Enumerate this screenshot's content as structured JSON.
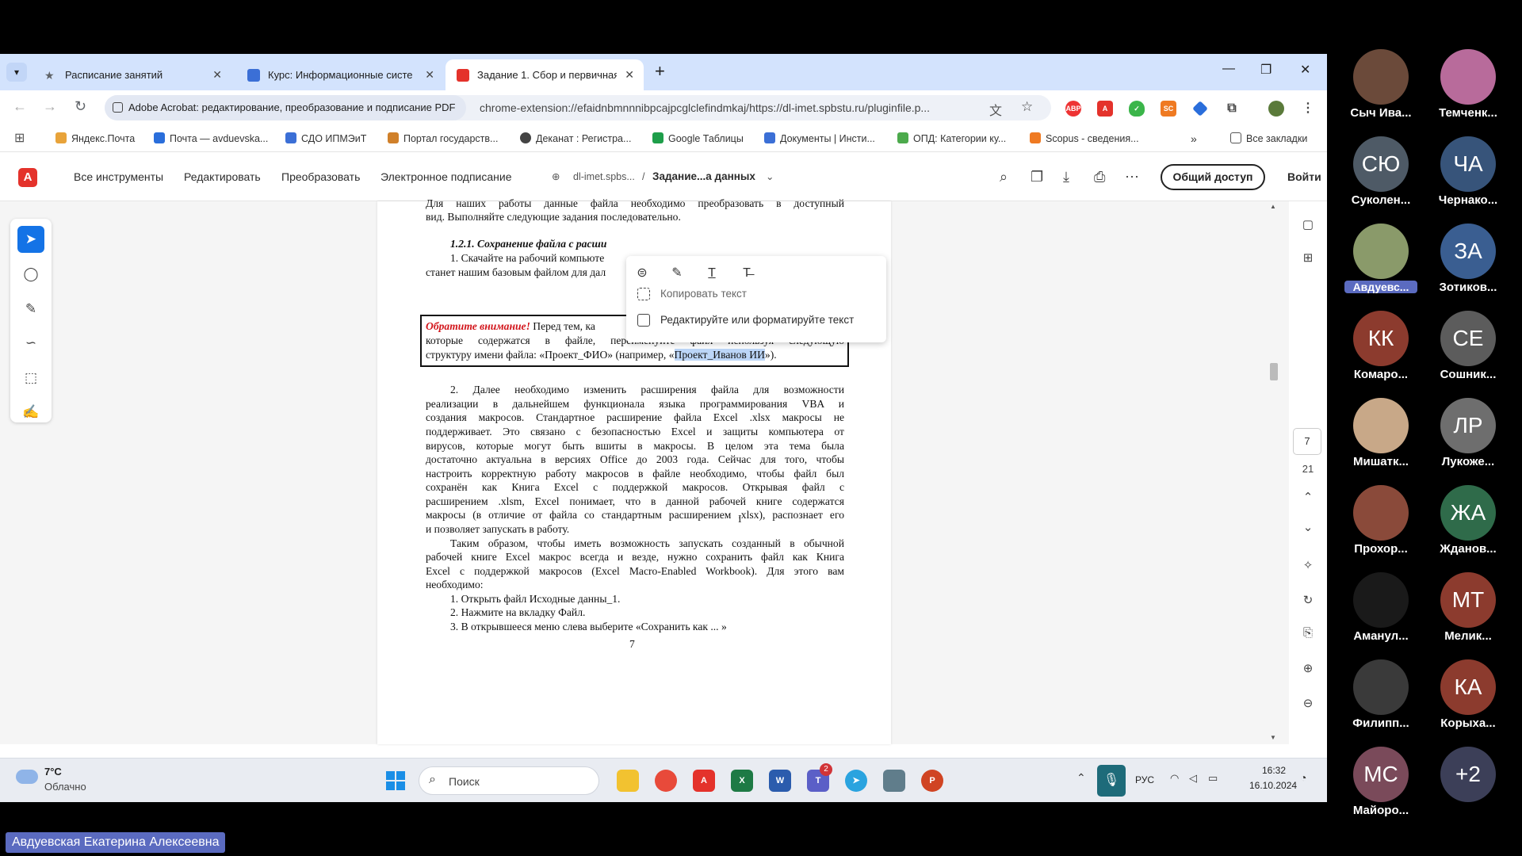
{
  "browser": {
    "tabs": [
      {
        "title": "Расписание занятий",
        "icon": "star-icon",
        "color": "#5f6368"
      },
      {
        "title": "Курс: Информационные систе",
        "icon": "moodle-icon",
        "color": "#3b6fd6"
      },
      {
        "title": "Задание 1. Сбор и первичная",
        "icon": "acrobat-icon",
        "color": "#e4322b"
      }
    ],
    "site_chip": "Adobe Acrobat: редактирование, преобразование и подписание PDF",
    "url": "chrome-extension://efaidnbmnnnibpcajpcglclefindmkaj/https://dl-imet.spbstu.ru/pluginfile.p...",
    "bookmarks": [
      "Яндекс.Почта",
      "Почта — avduevska...",
      "СДО ИПМЭиТ",
      "Портал государств...",
      "Деканат : Регистра...",
      "Google Таблицы",
      "Документы | Инсти...",
      "ОПД: Категории ку...",
      "Scopus - сведения..."
    ],
    "all_bookmarks": "Все закладки"
  },
  "acrobat": {
    "menu": [
      "Все инструменты",
      "Редактировать",
      "Преобразовать",
      "Электронное подписание"
    ],
    "crumb_site": "dl-imet.spbs...",
    "crumb_sep": "/",
    "crumb_doc": "Задание...а данных",
    "share": "Общий доступ",
    "signin": "Войти",
    "page_current": "7",
    "page_total": "21"
  },
  "doc": {
    "line_top1": "Для на­ших работы данные файла необходимо преобразовать в доступный",
    "line_top2": "вид. Выполняйте следующие задания последовательно.",
    "heading": "1.2.1. Сохранение файла с расши",
    "item1a": "1. Скачайте на рабочий компьюте",
    "item1b": "станет нашим базовым файлом для дал",
    "notice_label": "Обратите внимание!",
    "notice_l1": " Перед тем, ка",
    "notice_l2": "которые содержатся в файле, переименуйте файл используя следующую",
    "notice_l3a": "структуру имени файла: «Проект_ФИО» (например, «",
    "notice_hl": "Проект_Иванов ИИ",
    "notice_l3b": "»).",
    "para2": [
      "2. Далее необходимо изменить расширения файла для возможности",
      "реализации в дальнейшем функционала языка программирования VBA и",
      "создания макросов. Стандартное расширение файла Excel .xlsx макросы не",
      "поддерживает. Это связано с безопасностью Excel и защиты компьютера от",
      "вирусов, которые могут быть вшиты в макросы. В целом эта тема была",
      "достаточно актуальна в версиях Office до 2003 года. Сейчас для того, чтобы",
      "настроить корректную работу макросов в файле необходимо, чтобы файл был",
      "сохранён как Книга Excel с поддержкой макросов. Открывая файл с",
      "расширением .xlsm, Excel понимает, что в данной рабочей книге содержатся",
      "макросы (в отличие от файла со стандартным расширением .xlsx), распознает его"
    ],
    "para2_last": "и позволяет запускать в работу.",
    "para3": [
      "Таким образом, чтобы иметь возможность запускать созданный в обычной",
      "рабочей книге Excel макрос всегда и везде, нужно сохранить файл как Книга",
      "Excel с поддержкой макросов (Excel Macro-Enabled Workbook). Для этого вам"
    ],
    "para3_last": "необходимо:",
    "steps": [
      "1. Открыть файл Исходные данны_1.",
      "2. Нажмите на вкладку Файл.",
      "3. В открывшееся меню слева выберите «Сохранить как ... »"
    ],
    "page_number": "7"
  },
  "context_menu": {
    "copy": "Копировать текст",
    "edit": "Редактируйте или форматируйте текст"
  },
  "taskbar": {
    "temp": "7°C",
    "weather": "Облачно",
    "search": "Поиск",
    "lang": "РУС",
    "time": "16:32",
    "date": "16.10.2024",
    "teams_badge": "2"
  },
  "participants": [
    {
      "name": "Сыч Ива...",
      "initials": "",
      "color": "#6b4a3a"
    },
    {
      "name": "Темченк...",
      "initials": "",
      "color": "#b86b9b"
    },
    {
      "name": "Суколен...",
      "initials": "СЮ",
      "color": "#4e5a66"
    },
    {
      "name": "Чернако...",
      "initials": "ЧА",
      "color": "#37547a"
    },
    {
      "name": "Авдуевс...",
      "initials": "",
      "color": "#8a9a6a"
    },
    {
      "name": "Зотиков...",
      "initials": "ЗА",
      "color": "#3a5e91"
    },
    {
      "name": "Комаро...",
      "initials": "КК",
      "color": "#8c3b2e"
    },
    {
      "name": "Сошник...",
      "initials": "СЕ",
      "color": "#5c5c5c"
    },
    {
      "name": "Мишатк...",
      "initials": "",
      "color": "#c8a888"
    },
    {
      "name": "Лукоже...",
      "initials": "ЛР",
      "color": "#6e6e6e"
    },
    {
      "name": "Прохор...",
      "initials": "",
      "color": "#8a4a3a"
    },
    {
      "name": "Жданов...",
      "initials": "ЖА",
      "color": "#2f6b4a"
    },
    {
      "name": "Аманул...",
      "initials": "",
      "color": "#1a1a1a"
    },
    {
      "name": "Мелик...",
      "initials": "МТ",
      "color": "#8c3b2e"
    },
    {
      "name": "Филипп...",
      "initials": "",
      "color": "#3a3a3a"
    },
    {
      "name": "Корыха...",
      "initials": "КА",
      "color": "#8c3b2e"
    },
    {
      "name": "Майоро...",
      "initials": "МС",
      "color": "#7a4a5a"
    },
    {
      "name": "",
      "initials": "+2",
      "color": "#3c3f58"
    }
  ],
  "speaker": "Авдуевская Екатерина Алексеевна"
}
